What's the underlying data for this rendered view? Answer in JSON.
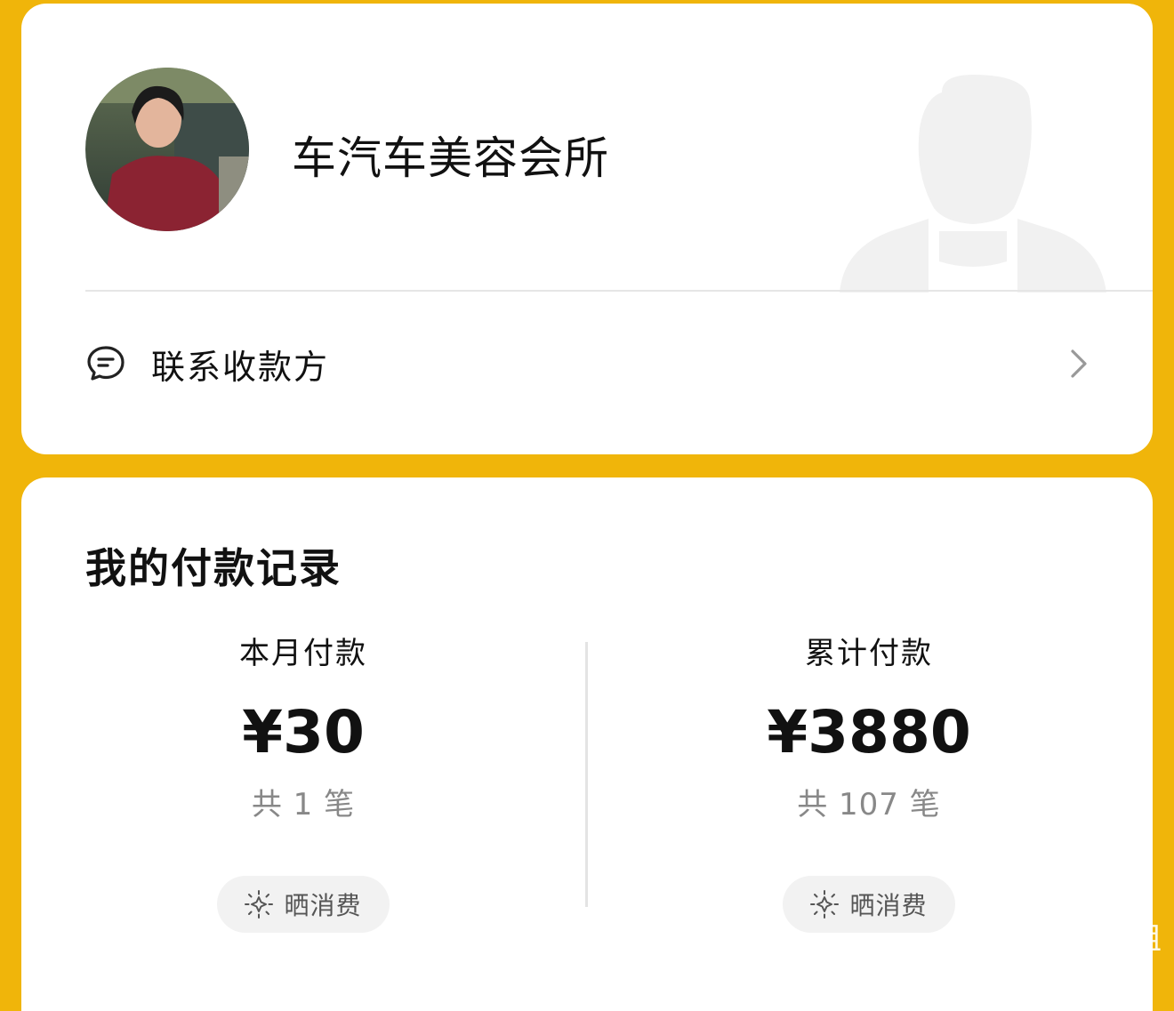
{
  "colors": {
    "background": "#F0B50A",
    "card": "#FFFFFF",
    "text_primary": "#111111",
    "text_secondary": "#888888"
  },
  "merchant": {
    "name": "车汽车美容会所",
    "avatar_icon": "merchant-avatar-photo"
  },
  "contact": {
    "label": "联系收款方",
    "icon": "chat-bubble-icon"
  },
  "records": {
    "title": "我的付款记录",
    "month": {
      "label": "本月付款",
      "amount": "¥30",
      "count": "共 1 笔",
      "share_label": "晒消费"
    },
    "total": {
      "label": "累计付款",
      "amount": "¥3880",
      "count": "共 107 笔",
      "share_label": "晒消费"
    }
  },
  "watermark": {
    "text": "@园姐"
  }
}
